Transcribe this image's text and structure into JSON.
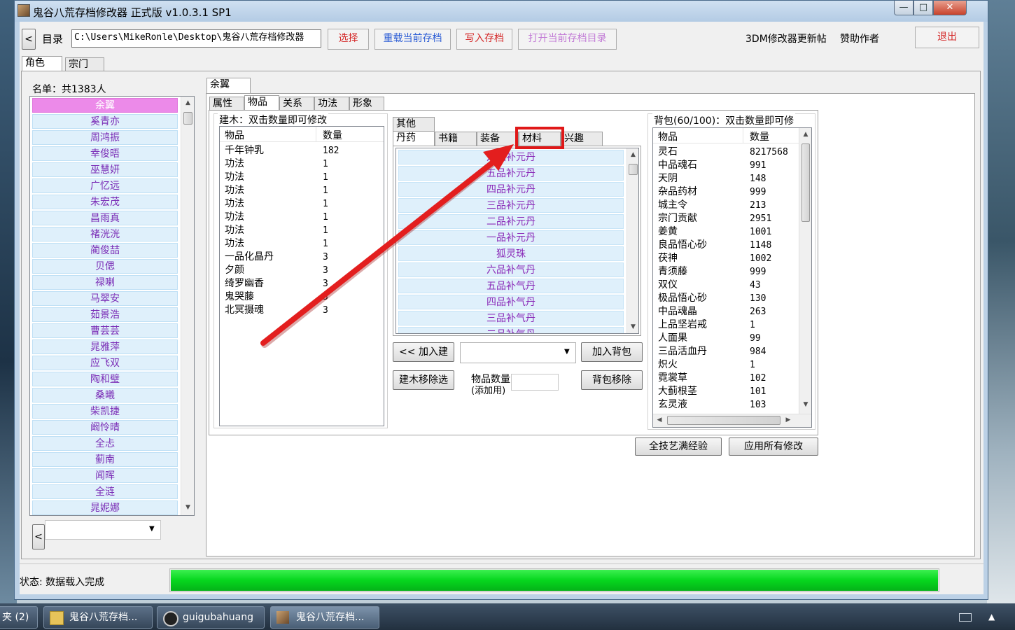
{
  "window": {
    "title": "鬼谷八荒存档修改器 正式版 v1.0.3.1 SP1",
    "min_glyph": "—",
    "max_glyph": "□",
    "close_glyph": "✕"
  },
  "toolbar": {
    "back_glyph": "<",
    "dir_label": "目录",
    "path_value": "C:\\Users\\MikeRonle\\Desktop\\鬼谷八荒存档修改器",
    "select": "选择",
    "reload": "重载当前存档",
    "write": "写入存档",
    "open_dir": "打开当前存档目录",
    "update_post": "3DM修改器更新帖",
    "sponsor": "赞助作者",
    "exit": "退出"
  },
  "main_tabs": [
    "角色",
    "宗门"
  ],
  "roster": {
    "title": "名单：共1383人",
    "selected_index": 0,
    "names": [
      "余翼",
      "奚青亦",
      "周鸿振",
      "幸俊晤",
      "巫慧妍",
      "广忆远",
      "朱宏茂",
      "昌雨真",
      "褚洸洸",
      "蔺俊喆",
      "贝偲",
      "禄喇",
      "马翠安",
      "茹景浩",
      "曹芸芸",
      "晁雅萍",
      "应飞双",
      "陶和璧",
      "桑曦",
      "柴凯捷",
      "阚怜晴",
      "全忐",
      "蓟南",
      "闻晖",
      "全涟",
      "晁妮娜"
    ],
    "back_glyph": "<"
  },
  "character": {
    "name_tab": "余翼",
    "sub_tabs": [
      "属性",
      "物品",
      "关系",
      "功法",
      "形象"
    ]
  },
  "build_panel": {
    "title": "建木：双击数量即可修改",
    "col_item": "物品",
    "col_qty": "数量",
    "rows": [
      {
        "name": "千年钟乳",
        "qty": "182"
      },
      {
        "name": "功法",
        "qty": "1"
      },
      {
        "name": "功法",
        "qty": "1"
      },
      {
        "name": "功法",
        "qty": "1"
      },
      {
        "name": "功法",
        "qty": "1"
      },
      {
        "name": "功法",
        "qty": "1"
      },
      {
        "name": "功法",
        "qty": "1"
      },
      {
        "name": "功法",
        "qty": "1"
      },
      {
        "name": "一品化晶丹",
        "qty": "3"
      },
      {
        "name": "夕颜",
        "qty": "3"
      },
      {
        "name": "绮罗幽香",
        "qty": "3"
      },
      {
        "name": "鬼哭藤",
        "qty": "3"
      },
      {
        "name": "北冥摄魂",
        "qty": "3"
      }
    ]
  },
  "catalog": {
    "tab_other": "其他",
    "tabs": [
      "丹药",
      "书籍",
      "装备",
      "材料",
      "兴趣"
    ],
    "highlighted_tab": "材料",
    "highlight_color": "#e01818",
    "items": [
      "六品补元丹",
      "五品补元丹",
      "四品补元丹",
      "三品补元丹",
      "二品补元丹",
      "一品补元丹",
      "狐灵珠",
      "六品补气丹",
      "五品补气丹",
      "四品补气丹",
      "三品补气丹",
      "二品补气丹"
    ],
    "add_build": "<< 加入建",
    "add_bag": "加入背包",
    "remove_build": "建木移除选",
    "qty_label": "物品数量",
    "qty_sub": "(添加用)",
    "remove_bag": "背包移除"
  },
  "bag": {
    "title": "背包(60/100)：双击数量即可修",
    "col_item": "物品",
    "col_qty": "数量",
    "rows": [
      {
        "name": "灵石",
        "qty": "8217568"
      },
      {
        "name": "中品魂石",
        "qty": "991"
      },
      {
        "name": "天阴",
        "qty": "148"
      },
      {
        "name": "杂品药材",
        "qty": "999"
      },
      {
        "name": "城主令",
        "qty": "213"
      },
      {
        "name": "宗门贡献",
        "qty": "2951"
      },
      {
        "name": "姜黄",
        "qty": "1001"
      },
      {
        "name": "良品悟心砂",
        "qty": "1148"
      },
      {
        "name": "茯神",
        "qty": "1002"
      },
      {
        "name": "青须藤",
        "qty": "999"
      },
      {
        "name": "双仪",
        "qty": "43"
      },
      {
        "name": "极品悟心砂",
        "qty": "130"
      },
      {
        "name": "中品魂晶",
        "qty": "263"
      },
      {
        "name": "上品坚岩戒",
        "qty": "1"
      },
      {
        "name": "人面果",
        "qty": "99"
      },
      {
        "name": "三品活血丹",
        "qty": "984"
      },
      {
        "name": "炽火",
        "qty": "1"
      },
      {
        "name": "霓裳草",
        "qty": "102"
      },
      {
        "name": "大蓟根茎",
        "qty": "101"
      },
      {
        "name": "玄灵液",
        "qty": "103"
      }
    ]
  },
  "actions": {
    "max_skill": "全技艺满经验",
    "apply": "应用所有修改"
  },
  "status": {
    "text": "状态: 数据载入完成",
    "progress": 1.0,
    "bar_color": "#06d61e"
  },
  "taskbar": {
    "items": [
      "夹 (2)",
      "鬼谷八荒存档...",
      "guigubahuang",
      "鬼谷八荒存档..."
    ]
  },
  "colors": {
    "name_text": "#7a2cb6",
    "selected_row": "#ec8ae9",
    "arrow": "#e31e1e"
  }
}
